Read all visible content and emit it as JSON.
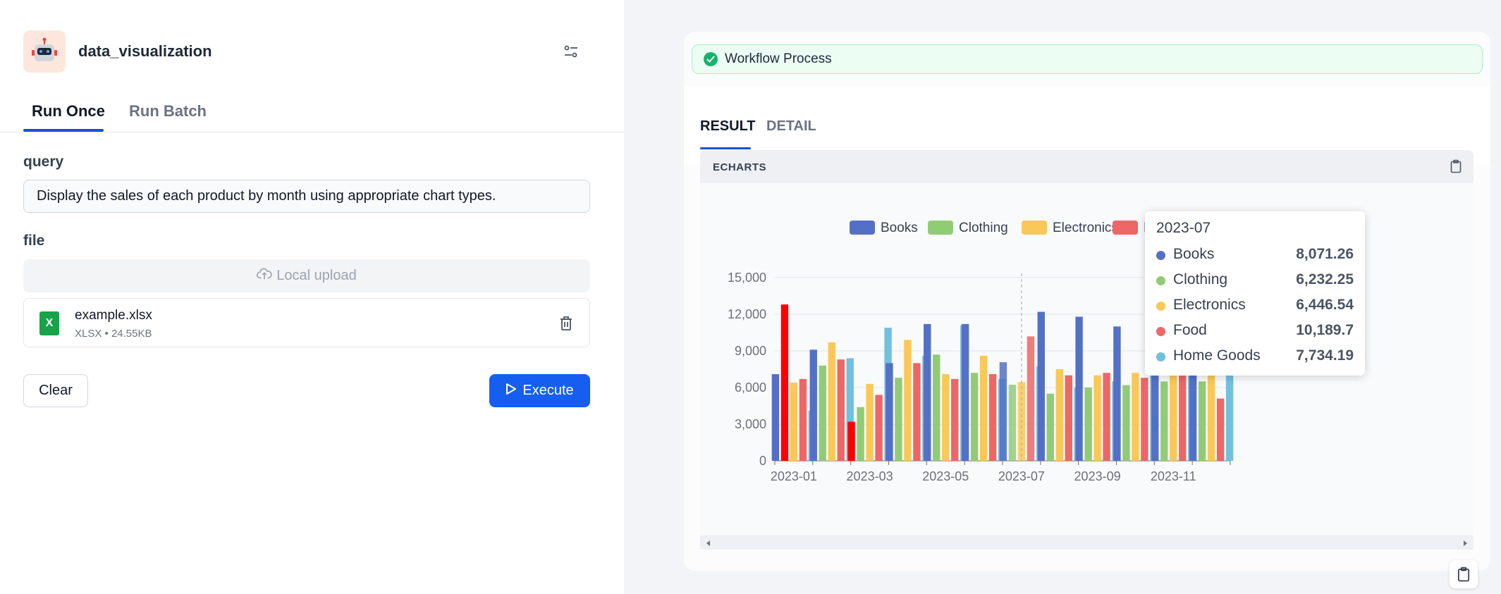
{
  "app": {
    "title": "data_visualization"
  },
  "left_tabs": {
    "run_once": "Run Once",
    "run_batch": "Run Batch"
  },
  "form": {
    "query_label": "query",
    "query_value": "Display the sales of each product by month using appropriate chart types.",
    "file_label": "file",
    "upload_label": "Local upload",
    "file": {
      "name": "example.xlsx",
      "meta": "XLSX • 24.55KB",
      "badge": "X"
    },
    "clear_label": "Clear",
    "execute_label": "Execute"
  },
  "result": {
    "banner": "Workflow Process",
    "tab_result": "RESULT",
    "tab_detail": "DETAIL",
    "echarts_label": "ECHARTS"
  },
  "colors": {
    "Books": "#5470c6",
    "Clothing": "#91cc75",
    "Electronics": "#fac858",
    "Food": "#ee6666",
    "Home Goods": "#73c0de",
    "highlight_red": "#ff0000",
    "primary": "#155eef"
  },
  "icons": [
    "robot-icon",
    "settings-sliders-icon",
    "cloud-upload-icon",
    "xlsx-file-icon",
    "trash-icon",
    "play-icon",
    "check-circle-icon",
    "clipboard-icon",
    "chevron-left-icon",
    "chevron-right-icon"
  ],
  "chart_data": {
    "type": "bar",
    "categories": [
      "2023-01",
      "2023-02",
      "2023-03",
      "2023-04",
      "2023-05",
      "2023-06",
      "2023-07",
      "2023-08",
      "2023-09",
      "2023-10",
      "2023-11",
      "2023-12"
    ],
    "x_tick_labels": [
      "2023-01",
      "2023-03",
      "2023-05",
      "2023-07",
      "2023-09",
      "2023-11"
    ],
    "y_ticks": [
      "0",
      "3,000",
      "6,000",
      "9,000",
      "12,000",
      "15,000"
    ],
    "ylim": [
      0,
      15000
    ],
    "legend": [
      "Books",
      "Clothing",
      "Electronics",
      "Food",
      "Home Goods"
    ],
    "legend_position": "top",
    "grid": true,
    "series": [
      {
        "name": "Books",
        "values": [
          7100,
          9100,
          0,
          8000,
          11200,
          11200,
          8071.26,
          12200,
          11800,
          11000,
          10500,
          12200
        ]
      },
      {
        "name": "Clothing",
        "values": [
          0,
          7800,
          4400,
          6800,
          8700,
          7200,
          6232.25,
          5500,
          6000,
          6200,
          6500,
          6500
        ]
      },
      {
        "name": "Electronics",
        "values": [
          6400,
          9700,
          6300,
          9900,
          7100,
          8600,
          6446.54,
          7500,
          7000,
          7200,
          7300,
          13500
        ]
      },
      {
        "name": "Food",
        "values": [
          6700,
          8300,
          5400,
          8000,
          6700,
          7100,
          10189.7,
          7000,
          7200,
          6800,
          7000,
          5100
        ]
      },
      {
        "name": "Home Goods",
        "values": [
          4100,
          8400,
          10900,
          8600,
          11100,
          6700,
          7734.19,
          6000,
          6500,
          7400,
          8000,
          12100
        ]
      }
    ],
    "highlight_bars": [
      {
        "category": "2023-01",
        "value": 12800
      },
      {
        "category": "2023-03",
        "value": 3200
      }
    ],
    "tooltip": {
      "title": "2023-07",
      "rows": [
        {
          "name": "Books",
          "value": "8,071.26"
        },
        {
          "name": "Clothing",
          "value": "6,232.25"
        },
        {
          "name": "Electronics",
          "value": "6,446.54"
        },
        {
          "name": "Food",
          "value": "10,189.7"
        },
        {
          "name": "Home Goods",
          "value": "7,734.19"
        }
      ]
    }
  }
}
